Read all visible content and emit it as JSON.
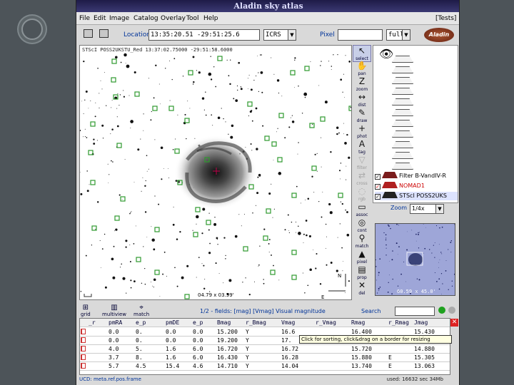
{
  "window": {
    "title": "Aladin sky atlas"
  },
  "menu": {
    "items": [
      "File",
      "Edit",
      "Image",
      "Catalog",
      "Overlay",
      "Tool",
      "Help"
    ],
    "right": "[Tests]"
  },
  "toolbar": {
    "location_label": "Location",
    "location_value": "13:35:20.51 -29:51:25.6",
    "frame_value": "ICRS",
    "pixel_label": "Pixel",
    "pixel_value": "",
    "pixel_mode": "full",
    "logo_text": "Aladin"
  },
  "view": {
    "label": "STScI POSS2UKSTU_Red 13:37:02.75000 -29:51:58.6000",
    "fov": "04.79 x 03.59'",
    "north": "N",
    "east": "E"
  },
  "tools": [
    {
      "name": "select",
      "label": "select",
      "glyph": "↖"
    },
    {
      "name": "pan",
      "label": "pan",
      "glyph": "✋"
    },
    {
      "name": "zoom",
      "label": "zoom",
      "glyph": "Z"
    },
    {
      "name": "dist",
      "label": "dist",
      "glyph": "↔"
    },
    {
      "name": "draw",
      "label": "draw",
      "glyph": "✎"
    },
    {
      "name": "phot",
      "label": "phot",
      "glyph": "+"
    },
    {
      "name": "tag",
      "label": "tag",
      "glyph": "A"
    },
    {
      "name": "filter",
      "label": "filter",
      "glyph": "▽"
    },
    {
      "name": "cross",
      "label": "cross",
      "glyph": "⇄"
    },
    {
      "name": "rgb",
      "label": "rgb",
      "glyph": "◌"
    },
    {
      "name": "assoc",
      "label": "assoc",
      "glyph": "▭"
    },
    {
      "name": "contour",
      "label": "cont",
      "glyph": "◎"
    },
    {
      "name": "match",
      "label": "match",
      "glyph": "⚲"
    },
    {
      "name": "pixel",
      "label": "pixel",
      "glyph": "▲"
    },
    {
      "name": "prop",
      "label": "prop",
      "glyph": "▤"
    },
    {
      "name": "del",
      "label": "del",
      "glyph": "✕"
    }
  ],
  "stack": {
    "layers": [
      {
        "name": "Filter B-VandIV-R",
        "checked": "✓"
      },
      {
        "name": "NOMAD1",
        "checked": "✓"
      },
      {
        "name": "STScI POSS2UKS",
        "checked": "✓"
      }
    ]
  },
  "zoom": {
    "label": "Zoom",
    "value": "1/4x"
  },
  "nav": {
    "label": "60.59 x 45.0'"
  },
  "bottombar": {
    "grid": "grid",
    "multiview": "multiview",
    "match": "match",
    "fields_text": "1/2 - fields: [mag] [Vmag] Visual magnitude",
    "search_label": "Search"
  },
  "table": {
    "headers": [
      "_r",
      "pmRA",
      "e_p",
      "pmDE",
      "e_p",
      "Bmag",
      "r_Bmag",
      "Vmag",
      "r_Vmag",
      "Rmag",
      "r_Rmag",
      "Jmag"
    ],
    "rows": [
      [
        "",
        "0.0",
        "0.",
        "0.0",
        "0.0",
        "15.200",
        "Y",
        "16.6",
        "",
        "16.400",
        "",
        "15.430"
      ],
      [
        "",
        "0.0",
        "0.",
        "0.0",
        "0.0",
        "19.200",
        "Y",
        "17.",
        "",
        "16.620",
        "",
        "16.340"
      ],
      [
        "",
        "4.0",
        "5.",
        "1.6",
        "6.0",
        "16.720",
        "Y",
        "16.72",
        "",
        "15.720",
        "",
        "14.880"
      ],
      [
        "",
        "3.7",
        "8.",
        "1.6",
        "6.0",
        "16.430",
        "Y",
        "16.28",
        "",
        "15.880",
        "E",
        "15.305"
      ],
      [
        "",
        "5.7",
        "4.5",
        "15.4",
        "4.6",
        "14.710",
        "Y",
        "14.04",
        "",
        "13.740",
        "E",
        "13.063"
      ]
    ]
  },
  "tooltip": "Click for sorting, click&drag on a border for resizing",
  "status": {
    "left": "UCD: meta.ref.pos.frame",
    "right": "used: 16632 sec   34Mb"
  }
}
